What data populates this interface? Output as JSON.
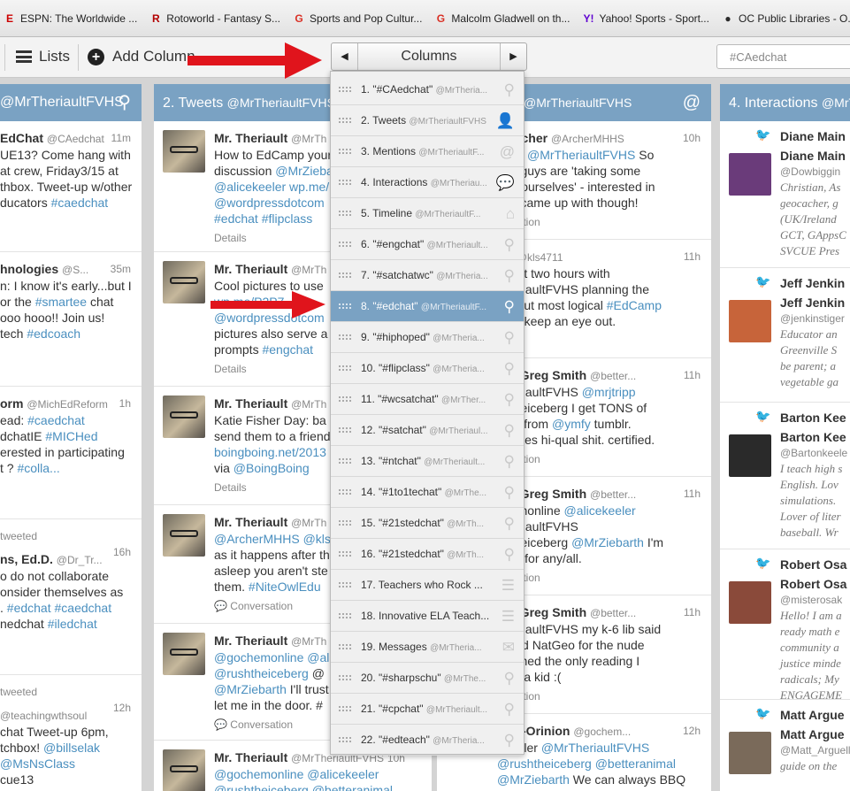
{
  "bookmarks": [
    {
      "label": "ESPN: The Worldwide ...",
      "icon": "espn-icon",
      "color": "#cc0000"
    },
    {
      "label": "Rotoworld - Fantasy S...",
      "icon": "rotoworld-icon",
      "color": "#b30000"
    },
    {
      "label": "Sports and Pop Cultur...",
      "icon": "google-icon",
      "color": "#d93025"
    },
    {
      "label": "Malcolm Gladwell on th...",
      "icon": "google-icon",
      "color": "#d93025"
    },
    {
      "label": "Yahoo! Sports - Sport...",
      "icon": "yahoo-icon",
      "color": "#5f01d1"
    },
    {
      "label": "OC Public Libraries - O...",
      "icon": "oc-library-icon",
      "color": "#2b2b2b"
    }
  ],
  "toolbar": {
    "lists_label": "Lists",
    "add_column_label": "Add Column",
    "columns_label": "Columns",
    "search_value": "#CAedchat"
  },
  "columns": {
    "col1": {
      "title": "",
      "handle": "@MrTheriaultFVHS"
    },
    "col2": {
      "title": "2. Tweets",
      "handle": "@MrTheriaultFVHS"
    },
    "col3": {
      "title": "",
      "handle": "@MrTheriaultFVHS"
    },
    "col4": {
      "title": "4. Interactions",
      "handle": "@MrTh"
    }
  },
  "col1_tweets": [
    {
      "name": "EdChat",
      "handle": "@CAedchat",
      "time": "11m",
      "lines": [
        "UE13? Come hang with",
        "at crew, Friday3/15 at",
        "thbox. Tweet-up w/other",
        "ducators #caedchat"
      ]
    },
    {
      "name": "hnologies",
      "handle": "@S...",
      "time": "35m",
      "lines": [
        "n: I know it's early...but I",
        "or the #smartee chat",
        "ooo hooo!! Join us!",
        "tech #edcoach"
      ]
    },
    {
      "name": "orm",
      "handle": "@MichEdReform",
      "time": "1h",
      "lines": [
        "ead: #caedchat",
        "dchatIE #MICHed",
        "erested in participating",
        "t ? #colla..."
      ]
    },
    {
      "name": "ns, Ed.D.",
      "handle": "@Dr_Tr...",
      "time": "16h",
      "pre": "tweeted",
      "lines": [
        "o do not collaborate",
        "onsider themselves as",
        ". #edchat #caedchat",
        "nedchat #iledchat"
      ]
    },
    {
      "name": "",
      "handle": "@teachingwthsoul",
      "time": "12h",
      "pre": "tweeted",
      "lines": [
        "chat Tweet-up 6pm,",
        "tchbox! @billselak",
        "@MsNsClass",
        "cue13"
      ]
    }
  ],
  "col2_tweets": [
    {
      "name": "Mr. Theriault",
      "handle": "@MrTh",
      "lines": [
        "How to EdCamp your",
        "discussion @MrZieba",
        "@alicekeeler wp.me/",
        "@wordpressdotcom",
        "#edchat #flipclass"
      ],
      "meta": "Details"
    },
    {
      "name": "Mr. Theriault",
      "handle": "@MrTh",
      "lines": [
        "Cool pictures to use",
        "wp.me/P2P7",
        "@wordpressdotcom",
        "pictures also serve a",
        "prompts #engchat"
      ],
      "meta": "Details"
    },
    {
      "name": "Mr. Theriault",
      "handle": "@MrTh",
      "lines": [
        "Katie Fisher Day: ba",
        "send them to a friend",
        "boingboing.net/2013",
        "via @BoingBoing"
      ],
      "meta": "Details"
    },
    {
      "name": "Mr. Theriault",
      "handle": "@MrTh",
      "lines": [
        "@ArcherMHHS @kls",
        "as it happens after th",
        "asleep you aren't ste",
        "them. #NiteOwlEdu"
      ],
      "meta": "Conversation"
    },
    {
      "name": "Mr. Theriault",
      "handle": "@MrTh",
      "lines": [
        "@gochemonline @al",
        "@rushtheiceberg @",
        "@MrZiebarth I'll trust",
        "let me in the door. #"
      ],
      "meta": "Conversation"
    },
    {
      "name": "Mr. Theriault",
      "handle": "@MrTheriaultFVHS",
      "time": "10h",
      "lines": [
        "@gochemonline @alicekeeler",
        "@rushtheiceberg @betteranimal"
      ],
      "meta": ""
    }
  ],
  "col3_tweets": [
    {
      "name": "n Archer",
      "handle": "@ArcherMHHS",
      "time": "10h",
      "lines": [
        "4711 @MrTheriaultFVHS So",
        "you guys are 'taking some",
        "for yourselves' - interested in",
        "you came up with though!"
      ],
      "meta": "versation"
    },
    {
      "name": "LS",
      "handle": "@kls4711",
      "time": "11h",
      "lines": [
        "spent two hours with",
        "TheriaultFVHS planning the",
        "est but most logical #EdCamp",
        "Yes, keep an eye out."
      ],
      "meta": "s"
    },
    {
      "name": "her Greg Smith",
      "handle": "@better...",
      "time": "11h",
      "lines": [
        "TheriaultFVHS @mrjtripp",
        "shtheiceberg I get TONS of",
        "stuff from @ymfy tumblr.",
        "curates hi-qual shit. certified."
      ],
      "meta": "versation"
    },
    {
      "name": "her Greg Smith",
      "handle": "@better...",
      "time": "11h",
      "lines": [
        "chemonline @alicekeeler",
        "TheriaultFVHS",
        "shtheiceberg @MrZiebarth I'm",
        "n dd for any/all."
      ],
      "meta": "versation"
    },
    {
      "name": "her Greg Smith",
      "handle": "@better...",
      "time": "11h",
      "lines": [
        "TheriaultFVHS my k-6 lib said",
        "I read NatGeo for the nude",
        "shamed the only reading I",
        "d as a kid :("
      ],
      "meta": "versation"
    },
    {
      "name": "inex-Orinion",
      "handle": "@gochem...",
      "time": "12h",
      "lines": [
        "ekeeler @MrTheriaultFVHS",
        "@rushtheiceberg @betteranimal",
        "@MrZiebarth We can always BBQ"
      ],
      "meta": ""
    }
  ],
  "col4_items": [
    {
      "name": "Diane Main",
      "name2": "Diane Main",
      "handle": "@Dowbiggin",
      "bio": [
        "Christian, As",
        "geocacher, g",
        "(UK/Ireland",
        "GCT, GAppsC",
        "SVCUE Pres"
      ]
    },
    {
      "name": "Jeff Jenkin",
      "name2": "Jeff Jenkin",
      "handle": "@jenkinstiger",
      "bio": [
        "Educator an",
        "Greenville S",
        "be parent; a",
        "vegetable ga"
      ]
    },
    {
      "name": "Barton Kee",
      "name2": "Barton Kee",
      "handle": "@Bartonkeele",
      "bio": [
        "I teach high s",
        "English. Lov",
        "simulations.",
        "Lover of liter",
        "baseball. Wr"
      ]
    },
    {
      "name": "Robert Osa",
      "name2": "Robert Osa",
      "handle": "@misterosak",
      "bio": [
        "Hello! I am a",
        "ready math e",
        "community a",
        "justice minde",
        "radicals; My",
        "ENGAGEME"
      ]
    },
    {
      "name": "Matt Argue",
      "name2": "Matt Argue",
      "handle": "@Matt_Arguell",
      "bio": [
        "guide on the"
      ]
    }
  ],
  "dropdown": [
    {
      "num": "1. \"#CAedchat\"",
      "h": "@MrTheria...",
      "icon": "search-icon"
    },
    {
      "num": "2. Tweets",
      "h": "@MrTheriaultFVHS",
      "icon": "user-icon"
    },
    {
      "num": "3. Mentions",
      "h": "@MrTheriaultF...",
      "icon": "at-icon"
    },
    {
      "num": "4. Interactions",
      "h": "@MrTheriau...",
      "icon": "speech-bubble-icon"
    },
    {
      "num": "5. Timeline",
      "h": "@MrTheriaultF...",
      "icon": "home-icon"
    },
    {
      "num": "6. \"#engchat\"",
      "h": "@MrTheriault...",
      "icon": "search-icon"
    },
    {
      "num": "7. \"#satchatwc\"",
      "h": "@MrTheria...",
      "icon": "search-icon"
    },
    {
      "num": "8. \"#edchat\"",
      "h": "@MrTheriaultF...",
      "icon": "search-icon",
      "selected": true
    },
    {
      "num": "9. \"#hiphoped\"",
      "h": "@MrTheria...",
      "icon": "search-icon"
    },
    {
      "num": "10. \"#flipclass\"",
      "h": "@MrTheria...",
      "icon": "search-icon"
    },
    {
      "num": "11. \"#wcsatchat\"",
      "h": "@MrTher...",
      "icon": "search-icon"
    },
    {
      "num": "12. \"#satchat\"",
      "h": "@MrTheriaul...",
      "icon": "search-icon"
    },
    {
      "num": "13. \"#ntchat\"",
      "h": "@MrTheriault...",
      "icon": "search-icon"
    },
    {
      "num": "14. \"#1to1techat\"",
      "h": "@MrThe...",
      "icon": "search-icon"
    },
    {
      "num": "15. \"#21stedchat\"",
      "h": "@MrTh...",
      "icon": "search-icon"
    },
    {
      "num": "16. \"#21stedchat\"",
      "h": "@MrTh...",
      "icon": "search-icon"
    },
    {
      "num": "17. Teachers who Rock ...",
      "h": "",
      "icon": "list-icon"
    },
    {
      "num": "18. Innovative ELA Teach...",
      "h": "",
      "icon": "list-icon"
    },
    {
      "num": "19. Messages",
      "h": "@MrTheria...",
      "icon": "envelope-icon"
    },
    {
      "num": "20. \"#sharpschu\"",
      "h": "@MrThe...",
      "icon": "search-icon"
    },
    {
      "num": "21. \"#cpchat\"",
      "h": "@MrTheriault...",
      "icon": "search-icon"
    },
    {
      "num": "22. \"#edteach\"",
      "h": "@MrTheria...",
      "icon": "search-icon"
    }
  ],
  "colors": {
    "header_blue": "#7aa2c3",
    "link_blue": "#4a8fbf",
    "arrow_red": "#e0141c"
  }
}
